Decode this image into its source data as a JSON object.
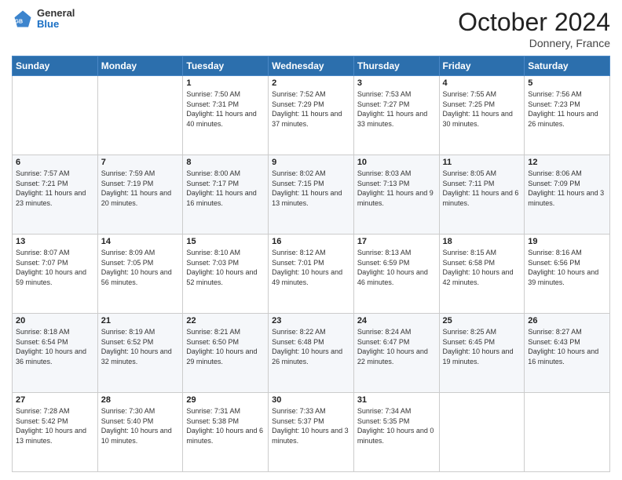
{
  "header": {
    "logo_general": "General",
    "logo_blue": "Blue",
    "month": "October 2024",
    "location": "Donnery, France"
  },
  "weekdays": [
    "Sunday",
    "Monday",
    "Tuesday",
    "Wednesday",
    "Thursday",
    "Friday",
    "Saturday"
  ],
  "weeks": [
    [
      {
        "day": "",
        "sunrise": "",
        "sunset": "",
        "daylight": ""
      },
      {
        "day": "",
        "sunrise": "",
        "sunset": "",
        "daylight": ""
      },
      {
        "day": "1",
        "sunrise": "Sunrise: 7:50 AM",
        "sunset": "Sunset: 7:31 PM",
        "daylight": "Daylight: 11 hours and 40 minutes."
      },
      {
        "day": "2",
        "sunrise": "Sunrise: 7:52 AM",
        "sunset": "Sunset: 7:29 PM",
        "daylight": "Daylight: 11 hours and 37 minutes."
      },
      {
        "day": "3",
        "sunrise": "Sunrise: 7:53 AM",
        "sunset": "Sunset: 7:27 PM",
        "daylight": "Daylight: 11 hours and 33 minutes."
      },
      {
        "day": "4",
        "sunrise": "Sunrise: 7:55 AM",
        "sunset": "Sunset: 7:25 PM",
        "daylight": "Daylight: 11 hours and 30 minutes."
      },
      {
        "day": "5",
        "sunrise": "Sunrise: 7:56 AM",
        "sunset": "Sunset: 7:23 PM",
        "daylight": "Daylight: 11 hours and 26 minutes."
      }
    ],
    [
      {
        "day": "6",
        "sunrise": "Sunrise: 7:57 AM",
        "sunset": "Sunset: 7:21 PM",
        "daylight": "Daylight: 11 hours and 23 minutes."
      },
      {
        "day": "7",
        "sunrise": "Sunrise: 7:59 AM",
        "sunset": "Sunset: 7:19 PM",
        "daylight": "Daylight: 11 hours and 20 minutes."
      },
      {
        "day": "8",
        "sunrise": "Sunrise: 8:00 AM",
        "sunset": "Sunset: 7:17 PM",
        "daylight": "Daylight: 11 hours and 16 minutes."
      },
      {
        "day": "9",
        "sunrise": "Sunrise: 8:02 AM",
        "sunset": "Sunset: 7:15 PM",
        "daylight": "Daylight: 11 hours and 13 minutes."
      },
      {
        "day": "10",
        "sunrise": "Sunrise: 8:03 AM",
        "sunset": "Sunset: 7:13 PM",
        "daylight": "Daylight: 11 hours and 9 minutes."
      },
      {
        "day": "11",
        "sunrise": "Sunrise: 8:05 AM",
        "sunset": "Sunset: 7:11 PM",
        "daylight": "Daylight: 11 hours and 6 minutes."
      },
      {
        "day": "12",
        "sunrise": "Sunrise: 8:06 AM",
        "sunset": "Sunset: 7:09 PM",
        "daylight": "Daylight: 11 hours and 3 minutes."
      }
    ],
    [
      {
        "day": "13",
        "sunrise": "Sunrise: 8:07 AM",
        "sunset": "Sunset: 7:07 PM",
        "daylight": "Daylight: 10 hours and 59 minutes."
      },
      {
        "day": "14",
        "sunrise": "Sunrise: 8:09 AM",
        "sunset": "Sunset: 7:05 PM",
        "daylight": "Daylight: 10 hours and 56 minutes."
      },
      {
        "day": "15",
        "sunrise": "Sunrise: 8:10 AM",
        "sunset": "Sunset: 7:03 PM",
        "daylight": "Daylight: 10 hours and 52 minutes."
      },
      {
        "day": "16",
        "sunrise": "Sunrise: 8:12 AM",
        "sunset": "Sunset: 7:01 PM",
        "daylight": "Daylight: 10 hours and 49 minutes."
      },
      {
        "day": "17",
        "sunrise": "Sunrise: 8:13 AM",
        "sunset": "Sunset: 6:59 PM",
        "daylight": "Daylight: 10 hours and 46 minutes."
      },
      {
        "day": "18",
        "sunrise": "Sunrise: 8:15 AM",
        "sunset": "Sunset: 6:58 PM",
        "daylight": "Daylight: 10 hours and 42 minutes."
      },
      {
        "day": "19",
        "sunrise": "Sunrise: 8:16 AM",
        "sunset": "Sunset: 6:56 PM",
        "daylight": "Daylight: 10 hours and 39 minutes."
      }
    ],
    [
      {
        "day": "20",
        "sunrise": "Sunrise: 8:18 AM",
        "sunset": "Sunset: 6:54 PM",
        "daylight": "Daylight: 10 hours and 36 minutes."
      },
      {
        "day": "21",
        "sunrise": "Sunrise: 8:19 AM",
        "sunset": "Sunset: 6:52 PM",
        "daylight": "Daylight: 10 hours and 32 minutes."
      },
      {
        "day": "22",
        "sunrise": "Sunrise: 8:21 AM",
        "sunset": "Sunset: 6:50 PM",
        "daylight": "Daylight: 10 hours and 29 minutes."
      },
      {
        "day": "23",
        "sunrise": "Sunrise: 8:22 AM",
        "sunset": "Sunset: 6:48 PM",
        "daylight": "Daylight: 10 hours and 26 minutes."
      },
      {
        "day": "24",
        "sunrise": "Sunrise: 8:24 AM",
        "sunset": "Sunset: 6:47 PM",
        "daylight": "Daylight: 10 hours and 22 minutes."
      },
      {
        "day": "25",
        "sunrise": "Sunrise: 8:25 AM",
        "sunset": "Sunset: 6:45 PM",
        "daylight": "Daylight: 10 hours and 19 minutes."
      },
      {
        "day": "26",
        "sunrise": "Sunrise: 8:27 AM",
        "sunset": "Sunset: 6:43 PM",
        "daylight": "Daylight: 10 hours and 16 minutes."
      }
    ],
    [
      {
        "day": "27",
        "sunrise": "Sunrise: 7:28 AM",
        "sunset": "Sunset: 5:42 PM",
        "daylight": "Daylight: 10 hours and 13 minutes."
      },
      {
        "day": "28",
        "sunrise": "Sunrise: 7:30 AM",
        "sunset": "Sunset: 5:40 PM",
        "daylight": "Daylight: 10 hours and 10 minutes."
      },
      {
        "day": "29",
        "sunrise": "Sunrise: 7:31 AM",
        "sunset": "Sunset: 5:38 PM",
        "daylight": "Daylight: 10 hours and 6 minutes."
      },
      {
        "day": "30",
        "sunrise": "Sunrise: 7:33 AM",
        "sunset": "Sunset: 5:37 PM",
        "daylight": "Daylight: 10 hours and 3 minutes."
      },
      {
        "day": "31",
        "sunrise": "Sunrise: 7:34 AM",
        "sunset": "Sunset: 5:35 PM",
        "daylight": "Daylight: 10 hours and 0 minutes."
      },
      {
        "day": "",
        "sunrise": "",
        "sunset": "",
        "daylight": ""
      },
      {
        "day": "",
        "sunrise": "",
        "sunset": "",
        "daylight": ""
      }
    ]
  ]
}
